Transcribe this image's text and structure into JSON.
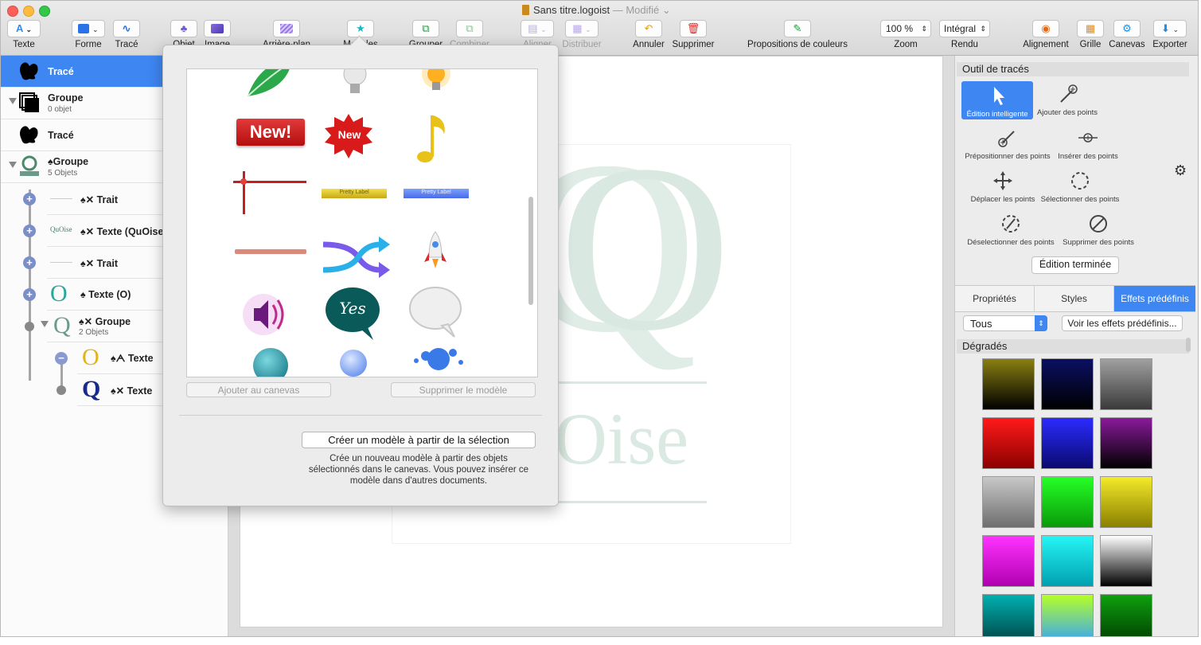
{
  "window": {
    "title": "Sans titre.logoist",
    "modified": "— Modifié"
  },
  "toolbar": {
    "texte": "Texte",
    "forme": "Forme",
    "trace": "Tracé",
    "objet": "Objet",
    "image": "Image",
    "arriere_plan": "Arrière-plan",
    "modeles": "Modèles",
    "grouper": "Grouper",
    "combiner": "Combiner",
    "aligner": "Aligner",
    "distribuer": "Distribuer",
    "annuler": "Annuler",
    "supprimer": "Supprimer",
    "propositions": "Propositions de couleurs",
    "zoom_value": "100 %",
    "zoom": "Zoom",
    "rendu_value": "Intégral",
    "rendu": "Rendu",
    "alignement": "Alignement",
    "grille": "Grille",
    "canevas": "Canevas",
    "exporter": "Exporter"
  },
  "layers": [
    {
      "name": "Tracé",
      "sub": ""
    },
    {
      "name": "Groupe",
      "sub": "0 objet"
    },
    {
      "name": "Tracé",
      "sub": ""
    },
    {
      "name": "Groupe",
      "sub": "5 Objets"
    },
    {
      "name": "Trait",
      "sub": ""
    },
    {
      "name": "Texte (QuOise",
      "sub": ""
    },
    {
      "name": "Trait",
      "sub": ""
    },
    {
      "name": "Texte (O)",
      "sub": ""
    },
    {
      "name": "Groupe",
      "sub": "2 Objets"
    },
    {
      "name": "Texte",
      "sub": ""
    },
    {
      "name": "Texte",
      "sub": ""
    }
  ],
  "thumb_text": {
    "quoise_small": "QuOise",
    "o_letter": "O",
    "q_letter": "Q"
  },
  "canvas": {
    "logo_q": "Q",
    "logo_o": "O",
    "logo_word": "QuOise"
  },
  "popover": {
    "items": [
      "New!",
      "New",
      "Pretty Label",
      "Pretty Label",
      "Yes"
    ],
    "add_button": "Ajouter au canevas",
    "delete_button": "Supprimer le modèle",
    "create_button": "Créer un modèle à partir de la sélection",
    "description": "Crée un nouveau modèle à partir des objets sélectionnés dans le canevas. Vous pouvez insérer ce modèle dans d'autres documents."
  },
  "right_panel": {
    "section_title": "Outil de tracés",
    "tools": [
      "Édition intelligente",
      "Ajouter des points",
      "Prépositionner des points",
      "Insérer des points",
      "Déplacer les points",
      "Sélectionner des points",
      "Déselectionner des points",
      "Supprimer des points"
    ],
    "done_button": "Édition terminée",
    "tabs": [
      "Propriétés",
      "Styles",
      "Effets prédéfinis"
    ],
    "active_tab": "Effets prédéfinis",
    "filter_value": "Tous",
    "view_button": "Voir les effets prédéfinis...",
    "gradients_title": "Dégradés"
  },
  "gradients": [
    [
      "#8a7f10",
      "#000000"
    ],
    [
      "#0b0f63",
      "#000000"
    ],
    [
      "#a0a0a0",
      "#3a3a3a"
    ],
    [
      "#ff1a1a",
      "#8c0000"
    ],
    [
      "#2b2bff",
      "#0a0a70"
    ],
    [
      "#8a1a9a",
      "#000000"
    ],
    [
      "#c8c8c8",
      "#6e6e6e"
    ],
    [
      "#26ff26",
      "#0a9a0a"
    ],
    [
      "#f4ea2a",
      "#8a8000"
    ],
    [
      "#ff33ff",
      "#b000b0"
    ],
    [
      "#26f5f5",
      "#00a0b0"
    ],
    [
      "#ffffff",
      "#000000"
    ],
    [
      "#00b0b0",
      "#004040"
    ],
    [
      "#b6ff26",
      "#30a0ff"
    ],
    [
      "#0ea00e",
      "#003a00"
    ]
  ]
}
